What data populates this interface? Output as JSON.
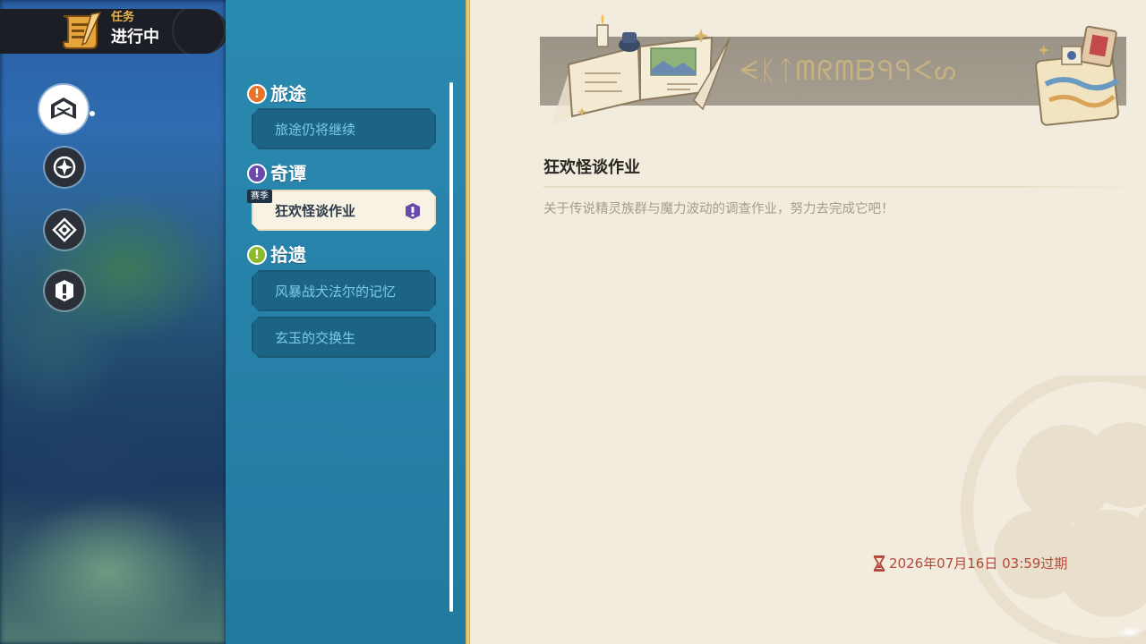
{
  "header": {
    "subtitle": "任务",
    "title": "进行中",
    "icon": "scroll-icon"
  },
  "nav": {
    "items": [
      {
        "icon": "quest-book-icon",
        "active": true
      },
      {
        "icon": "compass-emblem-icon",
        "active": false
      },
      {
        "icon": "diamond-emblem-icon",
        "active": false
      },
      {
        "icon": "exclamation-icon",
        "active": false
      }
    ]
  },
  "quest_list": {
    "sections": [
      {
        "label": "旅途",
        "icon": "exclamation-icon",
        "color": "#e8742b",
        "quests": [
          {
            "label": "旅途仍将继续",
            "selected": false
          }
        ]
      },
      {
        "label": "奇谭",
        "icon": "exclamation-icon",
        "color": "#6a4aa8",
        "quests": [
          {
            "label": "狂欢怪谈作业",
            "selected": true,
            "tag": "赛季"
          }
        ]
      },
      {
        "label": "拾遗",
        "icon": "exclamation-icon",
        "color": "#8bbb2c",
        "quests": [
          {
            "label": "风暴战犬法尔的记忆",
            "selected": false
          },
          {
            "label": "玄玉的交换生",
            "selected": false
          }
        ]
      }
    ]
  },
  "detail": {
    "title": "狂欢怪谈作业",
    "description": "关于传说精灵族群与魔力波动的调查作业，努力去完成它吧！",
    "expiry": "2026年07月16日 03:59过期",
    "expiry_icon": "hourglass-icon",
    "banner_text": "ᗕᛕᛏᗰᖇᗰᗷᑫᑫᐸᔕ"
  },
  "colors": {
    "panel_blue": "#2681a8",
    "card_blue": "#1c6485",
    "detail_bg": "#f2ecdf",
    "expiry_red": "#b4483a",
    "accent_gold": "#e8b34b"
  }
}
